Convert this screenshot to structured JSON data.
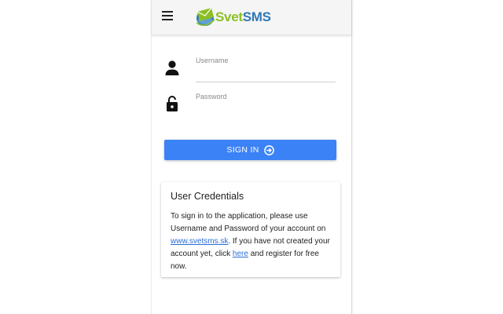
{
  "header": {
    "logo_part1": "Svet",
    "logo_part2": "SMS",
    "menu_icon": "hamburger-menu-icon"
  },
  "form": {
    "username_label": "Username",
    "username_value": "",
    "username_icon": "person-icon",
    "password_label": "Password",
    "password_value": "",
    "password_icon": "unlocked-padlock-icon",
    "signin_label": "SIGN IN",
    "signin_icon": "arrow-circle-right-icon"
  },
  "credentials_card": {
    "title": "User Credentials",
    "text_1": "To sign in to the application, please use Username and Password of your account on ",
    "link_1": "www.svetsms.sk",
    "text_2": ". If you have not created your account yet, click ",
    "link_2": "here",
    "text_3": " and register for free now."
  },
  "colors": {
    "primary": "#3b82f6",
    "logo_green": "#8cbf26",
    "logo_blue": "#2f78b7",
    "link": "#2a6fd6"
  }
}
